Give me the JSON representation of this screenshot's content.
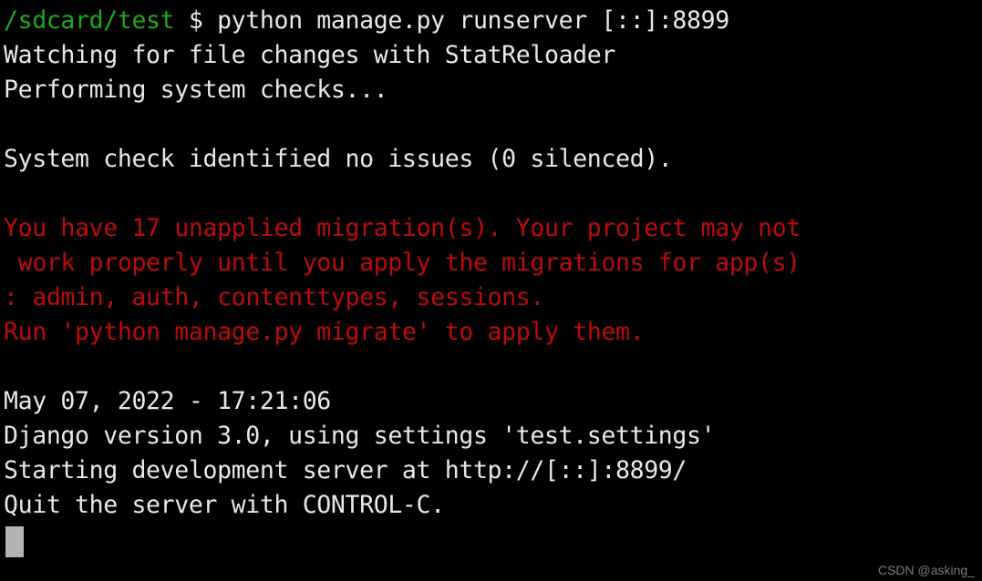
{
  "terminal": {
    "background_color": "#000000",
    "foreground_color": "#e8e8e8",
    "prompt_color": "#1fa81f",
    "warning_color": "#bb0b0b",
    "cursor_color": "#b2b2b2",
    "lines": [
      {
        "id": "prompt-command",
        "segments": [
          {
            "text": "/sdcard/test",
            "color": "green"
          },
          {
            "text": " $ python manage.py runserver [::]:8899",
            "color": "white"
          }
        ]
      },
      {
        "id": "statreloader",
        "segments": [
          {
            "text": "Watching for file changes with StatReloader",
            "color": "white"
          }
        ]
      },
      {
        "id": "performing-checks",
        "segments": [
          {
            "text": "Performing system checks...",
            "color": "white"
          }
        ]
      },
      {
        "id": "blank-1",
        "segments": [
          {
            "text": " ",
            "color": "white"
          }
        ]
      },
      {
        "id": "system-check-result",
        "segments": [
          {
            "text": "System check identified no issues (0 silenced).",
            "color": "white"
          }
        ]
      },
      {
        "id": "blank-2",
        "segments": [
          {
            "text": " ",
            "color": "white"
          }
        ]
      },
      {
        "id": "migrations-warning-1",
        "segments": [
          {
            "text": "You have 17 unapplied migration(s). Your project may not",
            "color": "red"
          }
        ]
      },
      {
        "id": "migrations-warning-2",
        "segments": [
          {
            "text": " work properly until you apply the migrations for app(s)",
            "color": "red"
          }
        ]
      },
      {
        "id": "migrations-warning-3",
        "segments": [
          {
            "text": ": admin, auth, contenttypes, sessions.",
            "color": "red"
          }
        ]
      },
      {
        "id": "migrate-hint",
        "segments": [
          {
            "text": "Run 'python manage.py migrate' to apply them.",
            "color": "red"
          }
        ]
      },
      {
        "id": "blank-3",
        "segments": [
          {
            "text": " ",
            "color": "white"
          }
        ]
      },
      {
        "id": "timestamp",
        "segments": [
          {
            "text": "May 07, 2022 - 17:21:06",
            "color": "white"
          }
        ]
      },
      {
        "id": "django-version",
        "segments": [
          {
            "text": "Django version 3.0, using settings 'test.settings'",
            "color": "white"
          }
        ]
      },
      {
        "id": "server-address",
        "segments": [
          {
            "text": "Starting development server at http://[::]:8899/",
            "color": "white"
          }
        ]
      },
      {
        "id": "quit-hint",
        "segments": [
          {
            "text": "Quit the server with CONTROL-C.",
            "color": "white"
          }
        ]
      }
    ]
  },
  "watermark": {
    "text": "CSDN @asking_"
  }
}
